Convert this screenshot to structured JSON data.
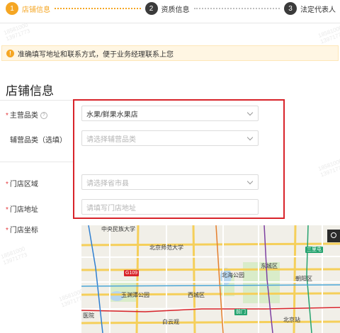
{
  "steps": [
    {
      "num": "1",
      "label": "店铺信息"
    },
    {
      "num": "2",
      "label": "资质信息"
    },
    {
      "num": "3",
      "label": "法定代表人"
    }
  ],
  "notice": {
    "text": "准确填写地址和联系方式，便于业务经理联系上您"
  },
  "section_title": "店铺信息",
  "form": {
    "main_category": {
      "label": "主营品类",
      "value": "水果/鲜果水果店"
    },
    "sub_category": {
      "label": "辅营品类（选填）",
      "placeholder": "请选择辅营品类"
    },
    "area": {
      "label": "门店区域",
      "placeholder": "请选择省市县"
    },
    "address": {
      "label": "门店地址",
      "placeholder": "请填写门店地址"
    },
    "coords": {
      "label": "门店坐标"
    }
  },
  "watermark": {
    "line1": "18581000",
    "line2": "13971773"
  },
  "map": {
    "labels": {
      "university": "中央民族大学",
      "beishida": "北京师范大学",
      "beihai": "北海公园",
      "dongcheng": "东城区",
      "yuyuantan": "玉渊潭公园",
      "xicheng": "西城区",
      "chaoyang": "朝阳区",
      "hospital": "医院",
      "baiyunguan": "白云观",
      "beijing_station": "北京站"
    },
    "tags": {
      "g109": "G109",
      "sanlitun": "三里屯",
      "qianmen": "前门"
    }
  },
  "colors": {
    "accent": "#f5a623",
    "highlight": "#d8232a",
    "required": "#e4393c"
  }
}
